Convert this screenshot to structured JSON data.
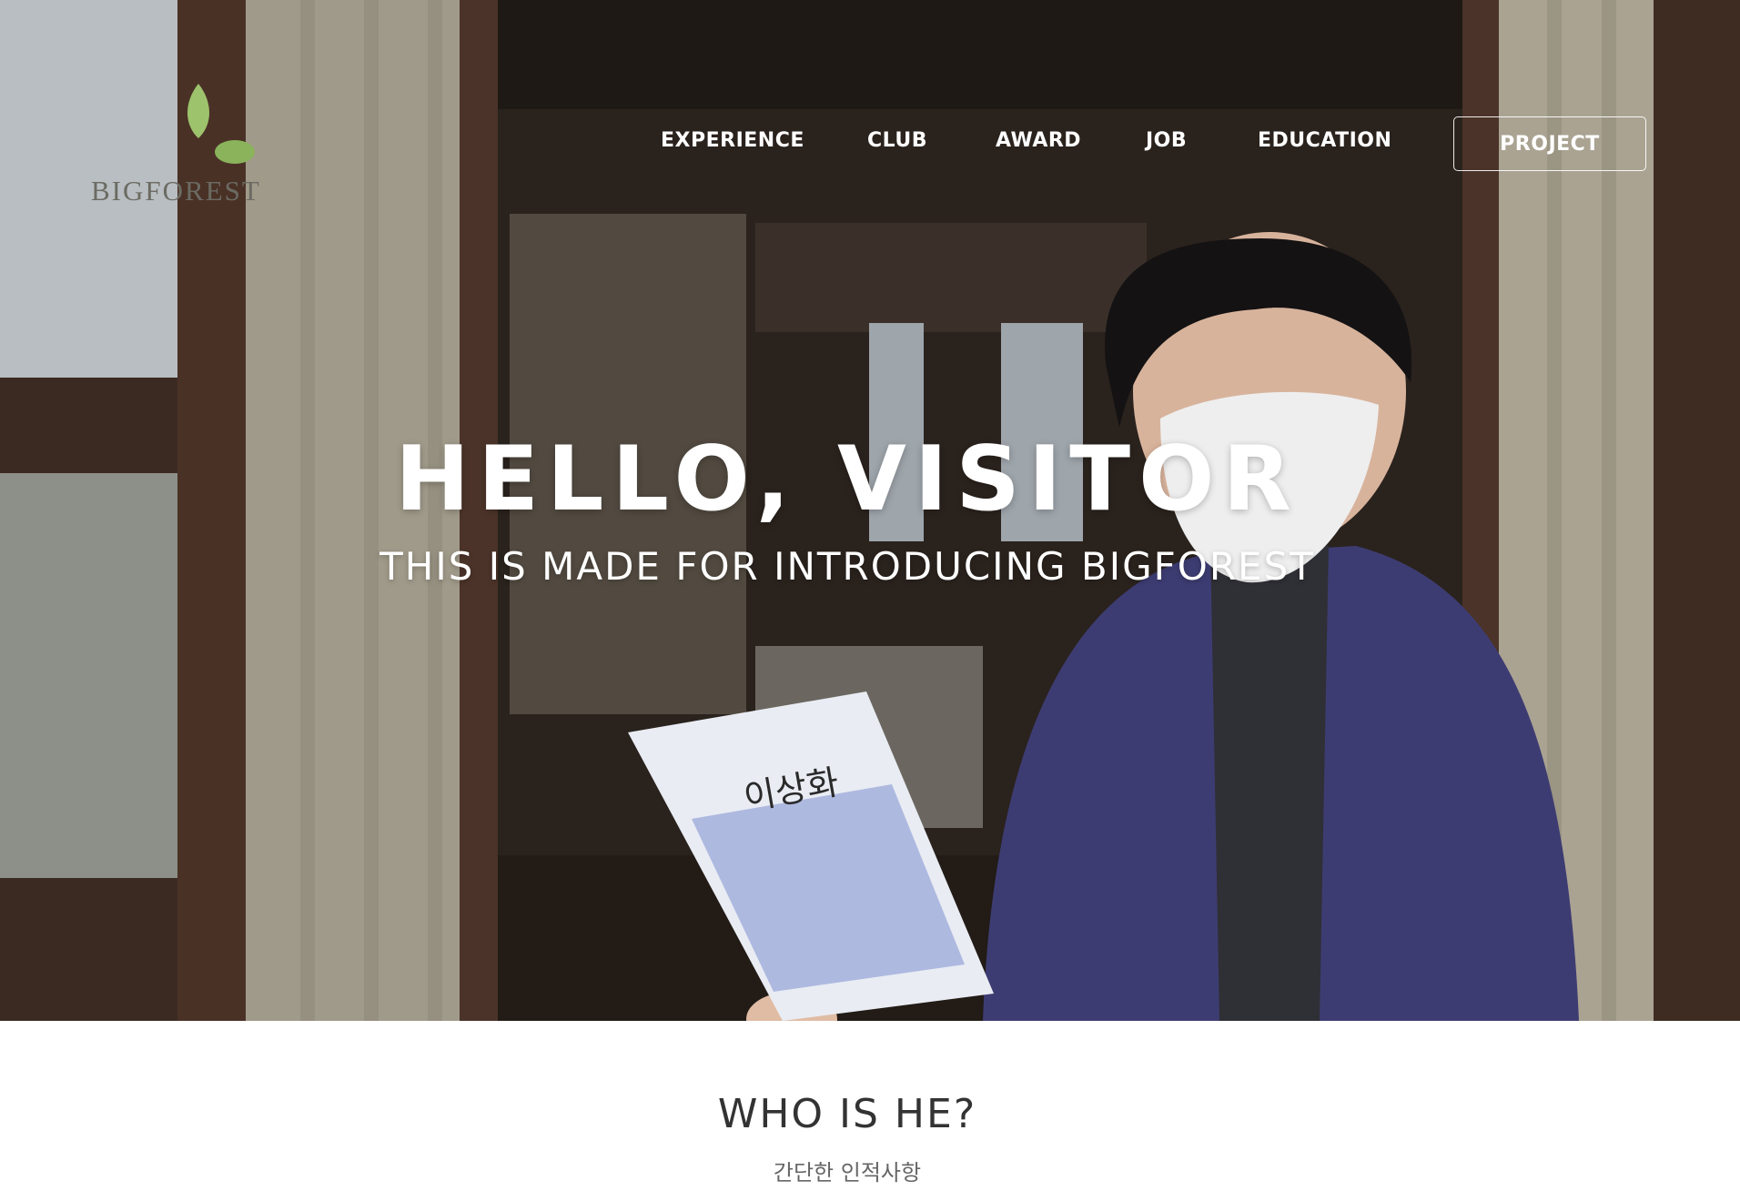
{
  "brand": {
    "logo_text": "BIGFOREST"
  },
  "nav": {
    "items": [
      {
        "label": "EXPERIENCE"
      },
      {
        "label": "CLUB"
      },
      {
        "label": "AWARD"
      },
      {
        "label": "JOB"
      },
      {
        "label": "EDUCATION"
      }
    ],
    "button_label": "PROJECT"
  },
  "hero": {
    "title": "HELLO, VISITOR",
    "subtitle": "THIS IS MADE FOR INTRODUCING BIGFOREST",
    "photo_booklet_text": "이상화"
  },
  "about": {
    "title": "WHO IS HE?",
    "subtitle": "간단한 인적사항"
  },
  "colors": {
    "leaf_green": "#9dc36c",
    "logo_gray": "#6b6b63",
    "button_border": "#ffffff",
    "heading_text": "#333333",
    "subheading_text": "#666666"
  }
}
